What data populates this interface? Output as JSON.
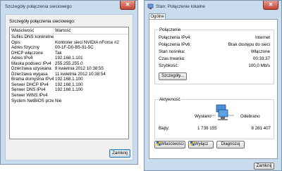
{
  "left_window": {
    "title": "Szczegóły połączenia sieciowego",
    "section_label": "Szczegóły połączenia sieciowego:",
    "columns": [
      "Właściwość",
      "Wartość"
    ],
    "rows": [
      [
        "Sufiks DNS konkretnego...",
        ""
      ],
      [
        "Opis",
        "Kontroler sieci NVIDIA nForce #2"
      ],
      [
        "Adres fizyczny",
        "00-1F-D0-B5-31-5C"
      ],
      [
        "DHCP włączone",
        "Tak"
      ],
      [
        "Adres IPv4",
        "192.168.1.101"
      ],
      [
        "Maska podsieci IPv4",
        "255.255.255.0"
      ],
      [
        "Dzierżawa uzyskana",
        "8 kwietnia 2012 10:38:55"
      ],
      [
        "Dzierżawa wygasa",
        "11 kwietnia 2012 10:38:54"
      ],
      [
        "Brama domyślna IPv4",
        "192.168.1.100"
      ],
      [
        "Serwer DHCP IPv4",
        "192.168.1.100"
      ],
      [
        "Serwer DNS IPv4",
        "192.168.1.100"
      ],
      [
        "Serwer WINS IPv4",
        ""
      ],
      [
        "System NetBIOS przez T...",
        "Nie"
      ]
    ],
    "close_label": "Zamknij"
  },
  "right_window": {
    "title": "Stan: Połączenie lokalne",
    "tab_general": "Ogólne",
    "connection_group": "Połączenie",
    "connection": [
      {
        "key": "Połączenia IPv4:",
        "value": "Internet"
      },
      {
        "key": "Połączenia IPv6:",
        "value": "Brak dostępu do sieci"
      },
      {
        "key": "Stan nośnika:",
        "value": "Włączone"
      },
      {
        "key": "Czas trwania:",
        "value": "00:33:37"
      },
      {
        "key": "Szybkość:",
        "value": "100,0 Mb/s"
      }
    ],
    "details_button": "Szczegóły...",
    "activity_group": "Aktywność",
    "sent_label": "Wysłano",
    "received_label": "Odebrano",
    "bytes_label": "Bajty:",
    "bytes_sent": "1 739 155",
    "bytes_received": "8 281 407",
    "properties_button": "Właściwości",
    "disable_button": "Wyłącz",
    "diagnose_button": "Diagnozuj",
    "close_label": "Zamknij"
  }
}
